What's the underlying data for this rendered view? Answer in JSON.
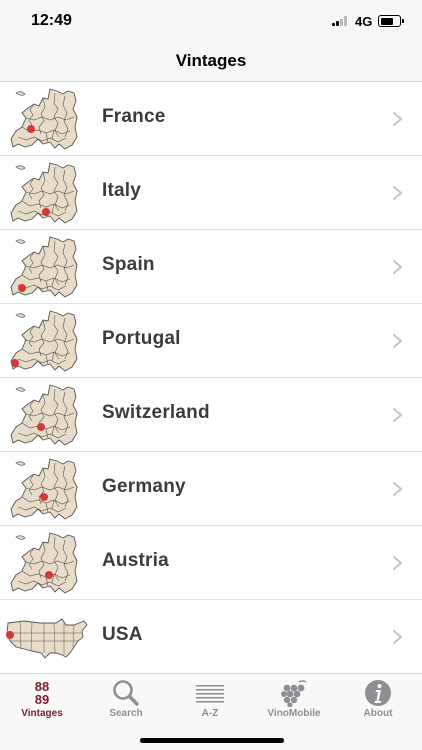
{
  "status_bar": {
    "time": "12:49",
    "carrier": "4G",
    "battery_level": 0.75
  },
  "nav": {
    "title": "Vintages"
  },
  "map_icons": {
    "europe": "europe-map-icon",
    "usa": "usa-map-icon"
  },
  "rows": [
    {
      "label": "France"
    },
    {
      "label": "Italy"
    },
    {
      "label": "Spain"
    },
    {
      "label": "Portugal"
    },
    {
      "label": "Switzerland"
    },
    {
      "label": "Germany"
    },
    {
      "label": "Austria"
    },
    {
      "label": "USA"
    }
  ],
  "tabs": [
    {
      "label": "Vintages",
      "icon": "vintages-88-89-icon",
      "selected": true
    },
    {
      "label": "Search",
      "icon": "search-icon",
      "selected": false
    },
    {
      "label": "A-Z",
      "icon": "list-icon",
      "selected": false
    },
    {
      "label": "VinoMobile",
      "icon": "grapes-icon",
      "selected": false
    },
    {
      "label": "About",
      "icon": "info-icon",
      "selected": false
    }
  ],
  "colors": {
    "accent": "#7a1e2c",
    "marker": "#d03a37",
    "map_fill": "#e8dcc8",
    "map_stroke": "#555555",
    "inactive": "#8e8e93"
  }
}
